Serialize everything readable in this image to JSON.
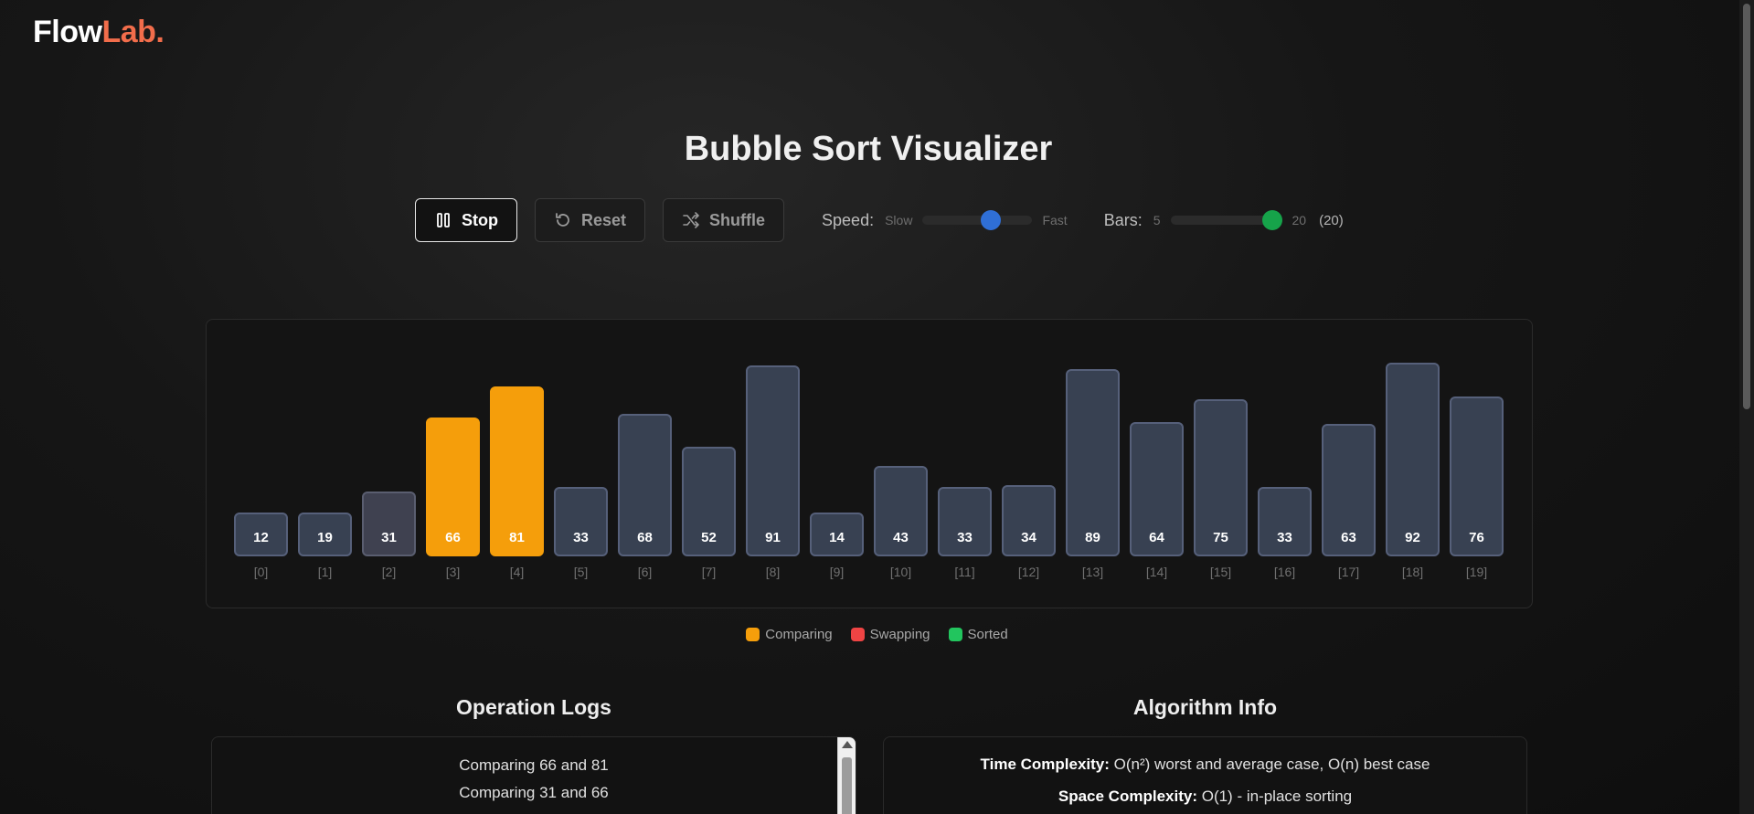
{
  "logo": {
    "part1": "Flow",
    "part2": "Lab."
  },
  "title": "Bubble Sort Visualizer",
  "controls": {
    "stop_label": "Stop",
    "reset_label": "Reset",
    "shuffle_label": "Shuffle",
    "speed_label": "Speed:",
    "speed_min": "Slow",
    "speed_max": "Fast",
    "speed_value": 0.65,
    "bars_label": "Bars:",
    "bars_min": "5",
    "bars_max": "20",
    "bars_count": "(20)",
    "bars_value": 20
  },
  "colors": {
    "comparing": "#f59e0b",
    "swapping": "#ef4444",
    "sorted": "#22c55e",
    "default_bar": "#384152",
    "speed_knob": "#2f6fd6",
    "bars_knob": "#16a34a"
  },
  "chart_data": {
    "type": "bar",
    "categories": [
      "[0]",
      "[1]",
      "[2]",
      "[3]",
      "[4]",
      "[5]",
      "[6]",
      "[7]",
      "[8]",
      "[9]",
      "[10]",
      "[11]",
      "[12]",
      "[13]",
      "[14]",
      "[15]",
      "[16]",
      "[17]",
      "[18]",
      "[19]"
    ],
    "values": [
      12,
      19,
      31,
      66,
      81,
      33,
      68,
      52,
      91,
      14,
      43,
      33,
      34,
      89,
      64,
      75,
      33,
      63,
      92,
      76
    ],
    "states": [
      "default",
      "default",
      "previous",
      "comparing",
      "comparing",
      "default",
      "default",
      "default",
      "default",
      "default",
      "default",
      "default",
      "default",
      "default",
      "default",
      "default",
      "default",
      "default",
      "default",
      "default"
    ],
    "ylim": [
      0,
      100
    ]
  },
  "legend": [
    {
      "label": "Comparing",
      "color": "#f59e0b"
    },
    {
      "label": "Swapping",
      "color": "#ef4444"
    },
    {
      "label": "Sorted",
      "color": "#22c55e"
    }
  ],
  "logs": {
    "title": "Operation Logs",
    "lines": [
      "Comparing 66 and 81",
      "Comparing 31 and 66"
    ]
  },
  "info": {
    "title": "Algorithm Info",
    "time_label": "Time Complexity:",
    "time_value": "O(n²) worst and average case, O(n) best case",
    "space_label": "Space Complexity:",
    "space_value": "O(1) - in-place sorting"
  }
}
